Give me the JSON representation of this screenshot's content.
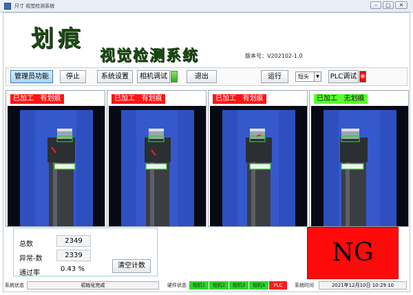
{
  "window": {
    "title": "尺寸 视觉检测系统",
    "controls": [
      "minimize-icon",
      "maximize-icon",
      "close-icon"
    ]
  },
  "header": {
    "logo_top": "划痕",
    "logo_bottom": "视觉检测系统",
    "version": "版本号：V202102-1.0",
    "logo_color": "#1e4a16"
  },
  "toolbar": {
    "admin": "管理员功能",
    "stop": "停止",
    "settings": "系统设置",
    "camera_debug": "相机调试",
    "exit": "退出",
    "run": "运行",
    "select_value": "短头",
    "plc_debug": "PLC调试",
    "camera_led": "green",
    "plc_led": "red"
  },
  "cameras": [
    {
      "status": "已加工   有划痕",
      "status_color": "red"
    },
    {
      "status": "已加工   有划痕",
      "status_color": "red"
    },
    {
      "status": "已加工   有划痕",
      "status_color": "red"
    },
    {
      "status": "已加工   无划痕",
      "status_color": "green"
    }
  ],
  "stats": {
    "total_label": "总数",
    "total_value": "2349",
    "abnormal_label": "异常-数",
    "abnormal_value": "2339",
    "pass_label": "通过率",
    "pass_value": "0.43 %",
    "clear_button": "清空计数"
  },
  "result": {
    "text": "NG",
    "color": "#ff0a0a"
  },
  "statusbar": {
    "system_state_label": "系统状态",
    "system_state_value": "初始化完成",
    "hardware_label": "硬件状态",
    "hardware": [
      {
        "name": "相机1",
        "state": "green"
      },
      {
        "name": "相机2",
        "state": "green"
      },
      {
        "name": "相机3",
        "state": "green"
      },
      {
        "name": "相机4",
        "state": "green"
      },
      {
        "name": "PLC",
        "state": "red"
      }
    ],
    "time_label": "系统时间",
    "time_value": "2021年12月10日   10:29:10"
  }
}
